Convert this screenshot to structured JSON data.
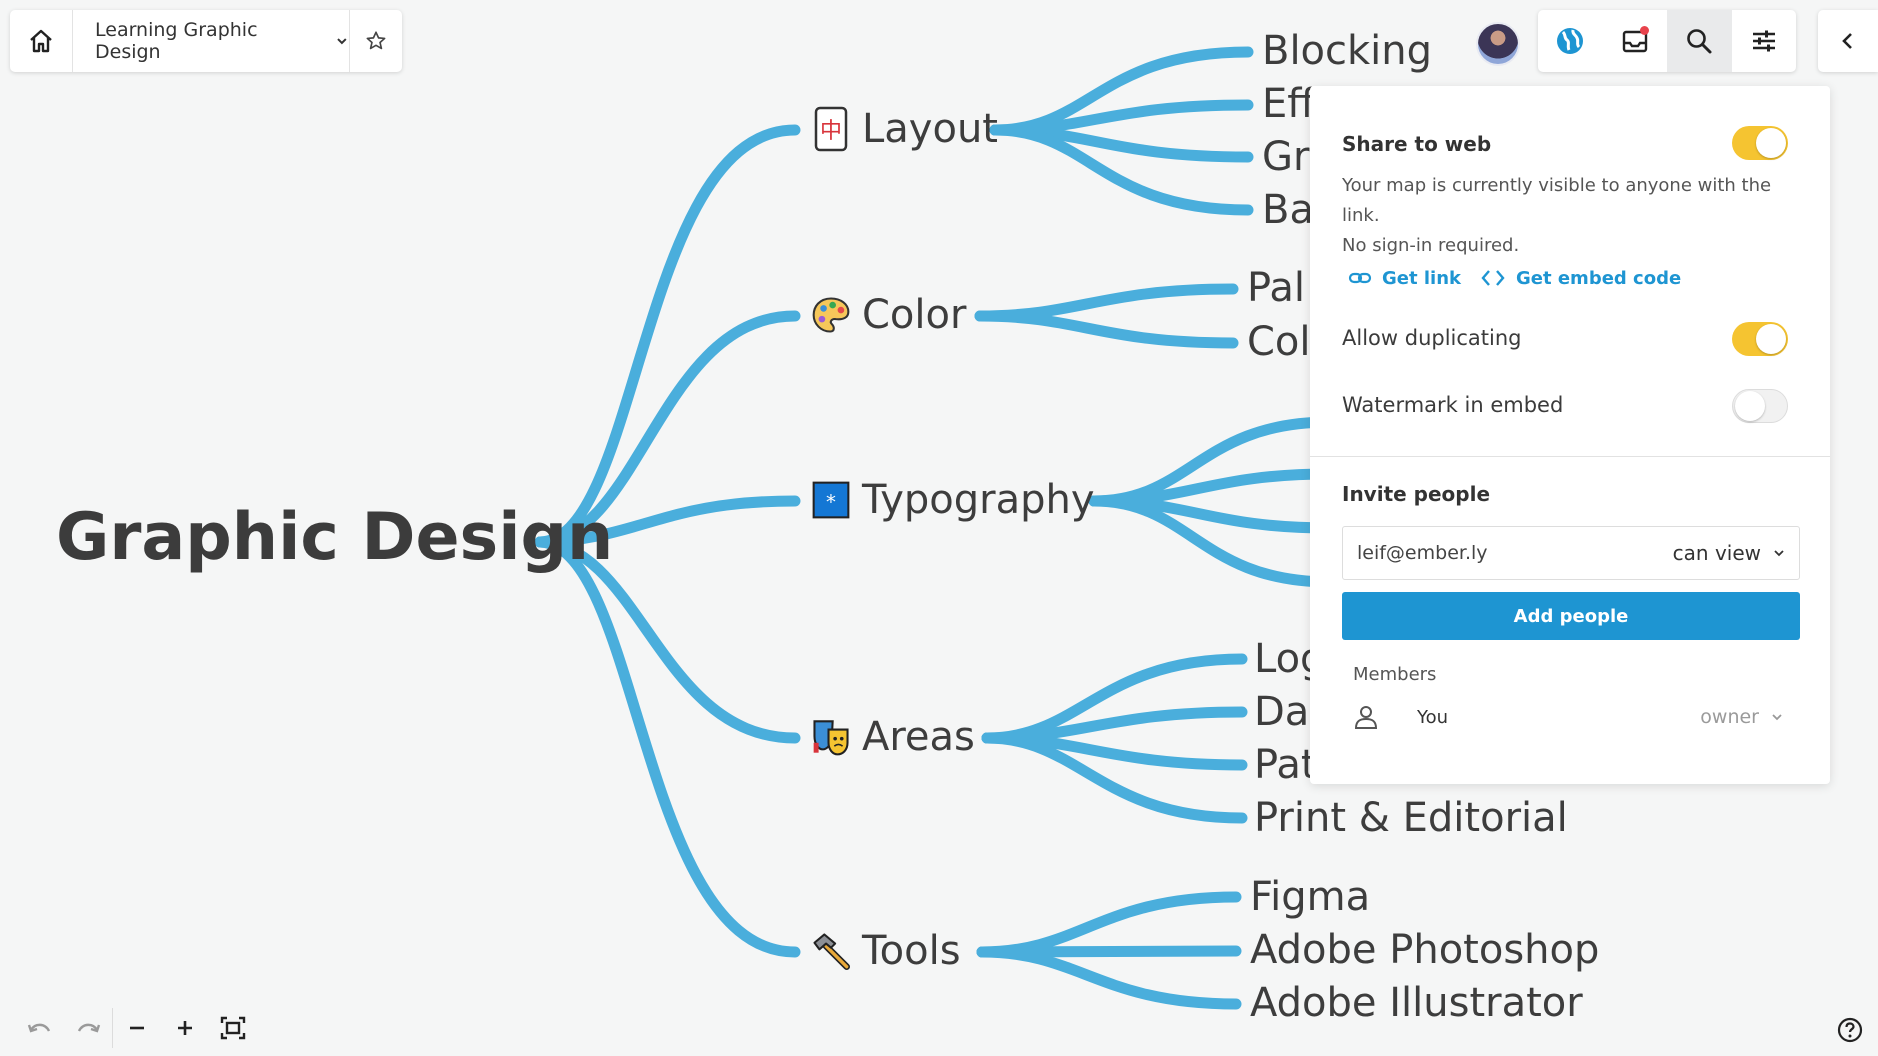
{
  "header": {
    "map_title": "Learning Graphic Design"
  },
  "mindmap": {
    "root": "Graphic Design",
    "branches": {
      "layout": {
        "label": "Layout",
        "icon": "mahjong-tile-icon",
        "children": [
          "Blocking",
          "Eff",
          "Gri",
          "Ba"
        ]
      },
      "color": {
        "label": "Color",
        "icon": "artist-palette-icon",
        "children": [
          "Pal",
          "Col"
        ]
      },
      "typography": {
        "label": "Typography",
        "icon": "asterisk-box-icon",
        "children": []
      },
      "areas": {
        "label": "Areas",
        "icon": "performing-arts-icon",
        "children": [
          "Log",
          "Dat",
          "Pat",
          "Print & Editorial"
        ]
      },
      "tools": {
        "label": "Tools",
        "icon": "hammer-icon",
        "children": [
          "Figma",
          "Adobe Photoshop",
          "Adobe Illustrator"
        ]
      }
    },
    "line_color": "#4aaedc"
  },
  "share_panel": {
    "share_to_web_label": "Share to web",
    "share_to_web_on": true,
    "share_description_line1": "Your map is currently visible to anyone with the link.",
    "share_description_line2": "No sign-in required.",
    "get_link_label": "Get link",
    "get_embed_label": "Get embed code",
    "allow_duplicating_label": "Allow duplicating",
    "allow_duplicating_on": true,
    "watermark_label": "Watermark in embed",
    "watermark_on": false,
    "invite_title": "Invite people",
    "invite_email_value": "leif@ember.ly",
    "invite_permission": "can view",
    "add_people_label": "Add people",
    "members_label": "Members",
    "members": [
      {
        "name": "You",
        "role": "owner"
      }
    ]
  },
  "colors": {
    "accent": "#1e95d2",
    "toggle_on": "#f5c431",
    "notification": "#e8434c",
    "background": "#f5f6f6"
  }
}
